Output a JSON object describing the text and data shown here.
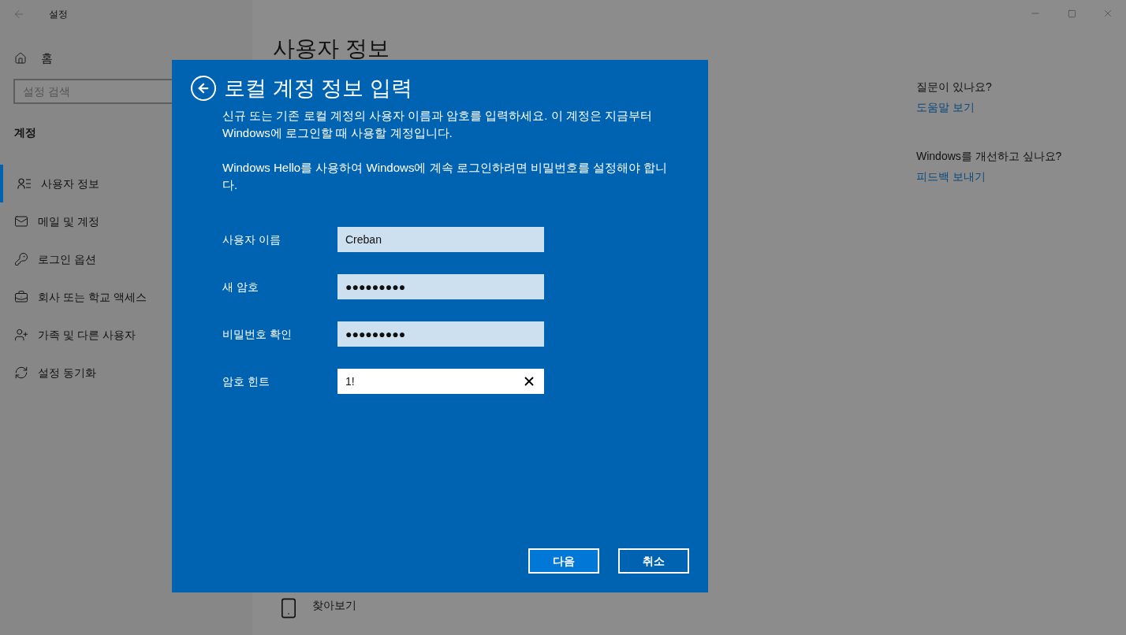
{
  "window": {
    "title": "설정"
  },
  "sidebar": {
    "home": "홈",
    "search": {
      "placeholder": "설정 검색"
    },
    "section": "계정",
    "items": [
      {
        "label": "사용자 정보",
        "kind": "userlist",
        "selected": true
      },
      {
        "label": "메일 및 계정",
        "kind": "mail",
        "selected": false
      },
      {
        "label": "로그인 옵션",
        "kind": "key",
        "selected": false
      },
      {
        "label": "회사 또는 학교 액세스",
        "kind": "briefcase",
        "selected": false
      },
      {
        "label": "가족 및 다른 사용자",
        "kind": "useradd",
        "selected": false
      },
      {
        "label": "설정 동기화",
        "kind": "sync",
        "selected": false
      }
    ]
  },
  "page": {
    "title": "사용자 정보",
    "browse": "찾아보기"
  },
  "aside": [
    {
      "question": "질문이 있나요?",
      "link": "도움말 보기"
    },
    {
      "question": "Windows를 개선하고 싶나요?",
      "link": "피드백 보내기"
    }
  ],
  "dialog": {
    "title": "로컬 계정 정보 입력",
    "paragraphs": [
      "신규 또는 기존 로컬 계정의 사용자 이름과 암호를 입력하세요. 이 계정은 지금부터 Windows에 로그인할 때 사용할 계정입니다.",
      "Windows Hello를 사용하여 Windows에 계속 로그인하려면 비밀번호를 설정해야 합니다."
    ],
    "fields": [
      {
        "label": "사용자 이름",
        "value": "Creban",
        "focused": false
      },
      {
        "label": "새 암호",
        "value": "●●●●●●●●●",
        "focused": false
      },
      {
        "label": "비밀번호 확인",
        "value": "●●●●●●●●●",
        "focused": false
      },
      {
        "label": "암호 힌트",
        "value": "1!",
        "focused": true
      }
    ],
    "buttons": [
      {
        "label": "다음",
        "kind": "primary"
      },
      {
        "label": "취소",
        "kind": "secondary"
      }
    ]
  }
}
